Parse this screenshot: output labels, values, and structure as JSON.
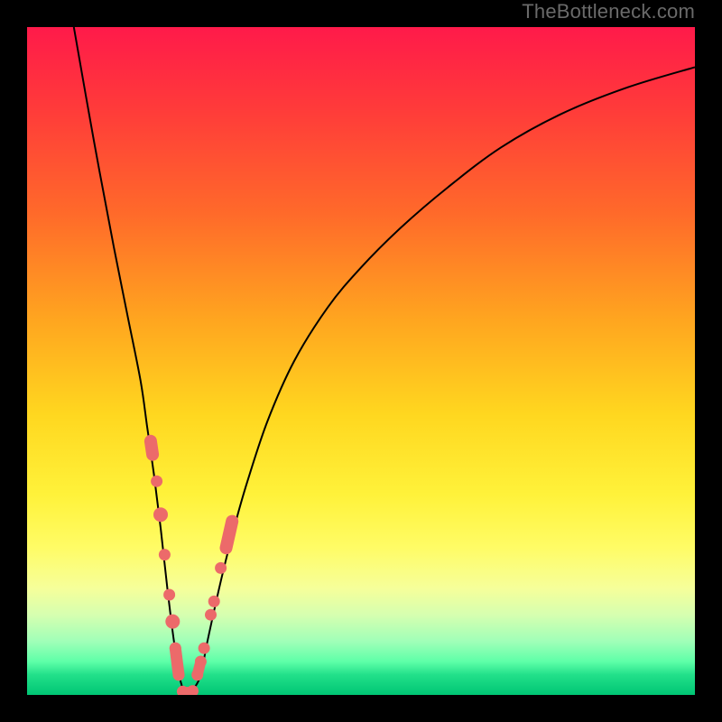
{
  "watermark": "TheBottleneck.com",
  "colors": {
    "frame": "#000000",
    "gradient_top": "#ff1a4a",
    "gradient_bottom": "#00c574",
    "curve": "#000000",
    "marker": "#ec6a6a"
  },
  "chart_data": {
    "type": "line",
    "title": "",
    "xlabel": "",
    "ylabel": "",
    "x_range_pct": [
      0,
      100
    ],
    "y_range_pct": [
      0,
      100
    ],
    "series": [
      {
        "name": "bottleneck-curve",
        "x_pct": [
          7,
          10,
          13,
          15,
          17,
          18,
          19,
          20,
          21,
          22,
          23,
          24,
          25,
          26,
          27,
          29,
          31,
          33,
          36,
          40,
          45,
          50,
          56,
          63,
          71,
          80,
          90,
          100
        ],
        "y_pct": [
          100,
          83,
          67,
          57,
          47,
          40,
          33,
          25,
          16,
          8,
          2,
          0,
          1,
          3,
          8,
          17,
          25,
          32,
          41,
          50,
          58,
          64,
          70,
          76,
          82,
          87,
          91,
          94
        ]
      }
    ],
    "left_branch_markers_xy_pct": [
      [
        18.8,
        36
      ],
      [
        18.5,
        38
      ],
      [
        19.4,
        32
      ],
      [
        20.0,
        27
      ],
      [
        20.6,
        21
      ],
      [
        21.3,
        15
      ],
      [
        21.8,
        11
      ],
      [
        22.2,
        7
      ],
      [
        22.7,
        3
      ]
    ],
    "right_branch_markers_xy_pct": [
      [
        25.5,
        3
      ],
      [
        26.0,
        5
      ],
      [
        26.5,
        7
      ],
      [
        27.5,
        12
      ],
      [
        28.0,
        14
      ],
      [
        29.0,
        19
      ],
      [
        29.8,
        22
      ],
      [
        30.7,
        26
      ]
    ],
    "bottom_markers_xy_pct": [
      [
        23.3,
        0.5
      ],
      [
        24.0,
        0.2
      ],
      [
        24.8,
        0.6
      ]
    ],
    "annotations": []
  }
}
